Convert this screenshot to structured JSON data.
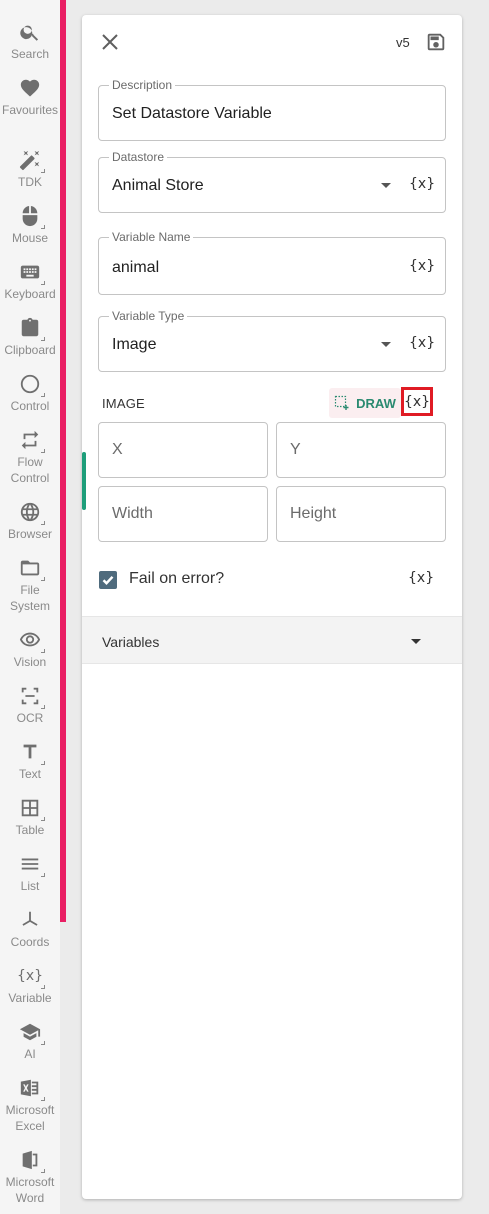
{
  "sidebar": {
    "items": [
      {
        "label": "Search",
        "icon": "search-icon"
      },
      {
        "label": "Favourites",
        "icon": "heart-icon"
      },
      {
        "label": "TDK",
        "icon": "magic-wand-icon"
      },
      {
        "label": "Mouse",
        "icon": "mouse-icon"
      },
      {
        "label": "Keyboard",
        "icon": "keyboard-icon"
      },
      {
        "label": "Clipboard",
        "icon": "clipboard-icon"
      },
      {
        "label": "Control",
        "icon": "circle-icon"
      },
      {
        "label": "Flow\nControl",
        "icon": "repeat-icon"
      },
      {
        "label": "Browser",
        "icon": "globe-icon"
      },
      {
        "label": "File\nSystem",
        "icon": "folder-icon"
      },
      {
        "label": "Vision",
        "icon": "eye-icon"
      },
      {
        "label": "OCR",
        "icon": "ocr-icon"
      },
      {
        "label": "Text",
        "icon": "text-icon"
      },
      {
        "label": "Table",
        "icon": "table-icon"
      },
      {
        "label": "List",
        "icon": "list-icon"
      },
      {
        "label": "Coords",
        "icon": "axes-icon"
      },
      {
        "label": "Variable",
        "icon": "variable-icon"
      },
      {
        "label": "AI",
        "icon": "graduation-cap-icon"
      },
      {
        "label": "Microsoft\nExcel",
        "icon": "excel-icon"
      },
      {
        "label": "Microsoft\nWord",
        "icon": "word-icon"
      }
    ]
  },
  "header": {
    "version": "v5"
  },
  "form": {
    "description": {
      "label": "Description",
      "value": "Set Datastore Variable"
    },
    "datastore": {
      "label": "Datastore",
      "value": "Animal Store",
      "var": "{x}"
    },
    "variable_name": {
      "label": "Variable Name",
      "value": "animal",
      "var": "{x}"
    },
    "variable_type": {
      "label": "Variable Type",
      "value": "Image",
      "var": "{x}"
    }
  },
  "image_section": {
    "title": "IMAGE",
    "draw_label": "DRAW",
    "var": "{x}",
    "x_placeholder": "X",
    "y_placeholder": "Y",
    "width_placeholder": "Width",
    "height_placeholder": "Height"
  },
  "fail_on_error": {
    "label": "Fail on error?",
    "checked": true,
    "var": "{x}"
  },
  "variables": {
    "label": "Variables"
  },
  "colors": {
    "accent": "#e91e63",
    "draw_green": "#2a8a70",
    "highlight": "#e01b24"
  }
}
